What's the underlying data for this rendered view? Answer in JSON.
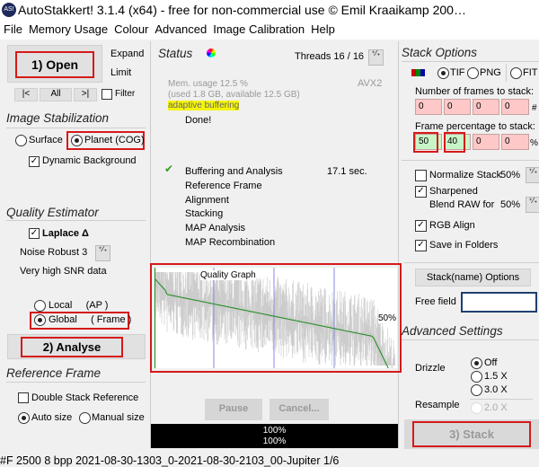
{
  "title": "AutoStakkert! 3.1.4 (x64) - free for non-commercial use © Emil Kraaikamp 200…",
  "menu": [
    "File",
    "Memory Usage",
    "Colour",
    "Advanced",
    "Image Calibration",
    "Help"
  ],
  "left": {
    "open_label": "1) Open",
    "expand": "Expand",
    "limit": "Limit",
    "nav": [
      "|<",
      "All",
      ">|"
    ],
    "filter": "Filter",
    "stab_heading": "Image Stabilization",
    "surface": "Surface",
    "planet": "Planet (COG)",
    "dynamic_bg": "Dynamic Background",
    "qe_heading": "Quality Estimator",
    "laplace": "Laplace Δ",
    "noise_robust": "Noise Robust  3",
    "snr": "Very high SNR data",
    "local": "Local     (AP )",
    "global": "Global     ( Frame )",
    "analyse_label": "2) Analyse",
    "ref_heading": "Reference Frame",
    "double_stack": "Double Stack Reference",
    "auto_size": "Auto size",
    "manual_size": "Manual size"
  },
  "status": {
    "heading": "Status",
    "threads": "Threads 16 / 16",
    "avx": "AVX2",
    "mem": "Mem. usage 12.5 %",
    "used": "(used 1.8 GB, available 12.5 GB)",
    "buffering": "adaptive buffering",
    "done": "Done!",
    "steps": [
      {
        "label": "Buffering and Analysis",
        "time": "17.1 sec.",
        "done": true
      },
      {
        "label": "Reference Frame"
      },
      {
        "label": "Alignment"
      },
      {
        "label": "Stacking"
      },
      {
        "label": "MAP Analysis"
      },
      {
        "label": "MAP Recombination"
      }
    ],
    "graph_title": "Quality Graph",
    "graph_pct": "50%",
    "pause": "Pause",
    "cancel": "Cancel...",
    "progress1": "100%",
    "progress2": "100%",
    "progress_value": 100
  },
  "stack": {
    "heading": "Stack Options",
    "formats": [
      "TIF",
      "PNG",
      "FIT"
    ],
    "selected_format": "TIF",
    "num_label": "Number of frames to stack:",
    "num_values": [
      "0",
      "0",
      "0",
      "0"
    ],
    "num_unit": "#",
    "pct_label": "Frame percentage to stack:",
    "pct_values": [
      "50",
      "40",
      "0",
      "0"
    ],
    "pct_unit": "%",
    "normalize": "Normalize Stack",
    "normalize_val": "50%",
    "sharpened": "Sharpened",
    "blend": "Blend RAW for",
    "blend_val": "50%",
    "rgb_align": "RGB Align",
    "save_folders": "Save in Folders",
    "name_options": "Stack(name) Options",
    "free_field": "Free field",
    "free_value": "",
    "adv_heading": "Advanced Settings",
    "drizzle": "Drizzle",
    "drizzle_opts": [
      "Off",
      "1.5 X",
      "3.0 X"
    ],
    "resample": "Resample",
    "resample_opt": "2.0 X",
    "stack_label": "3) Stack"
  },
  "statusbar": "#F 2500  8 bpp 2021-08-30-1303_0-2021-08-30-2103_00-Jupiter 1/6",
  "colors": {
    "highlight": "#f5f50a",
    "red_outline": "#d51a1a",
    "field_red": "#ffc8c8",
    "field_green": "#c8f5c8",
    "curve": "#1a8a1a"
  }
}
